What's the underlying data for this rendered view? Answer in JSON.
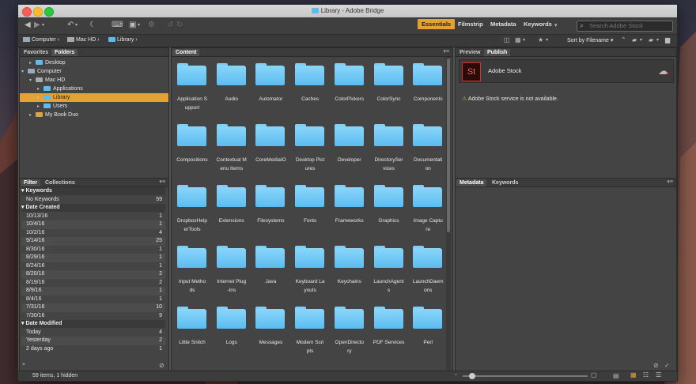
{
  "window": {
    "title": "Library - Adobe Bridge"
  },
  "toolbar": {
    "workspaces": [
      "Essentials",
      "Filmstrip",
      "Metadata",
      "Keywords"
    ],
    "active_workspace": "Essentials",
    "search_placeholder": "Search Adobe Stock"
  },
  "breadcrumb": [
    "Computer",
    "Mac HD",
    "Library"
  ],
  "sort": {
    "label": "Sort by Filename"
  },
  "favorites_tab": "Favorites",
  "folders_tab": "Folders",
  "tree": [
    {
      "label": "Desktop",
      "indent": 1,
      "arrow": "▸",
      "selected": false
    },
    {
      "label": "Computer",
      "indent": 0,
      "arrow": "▾",
      "selected": false
    },
    {
      "label": "Mac HD",
      "indent": 1,
      "arrow": "▾",
      "selected": false
    },
    {
      "label": "Applications",
      "indent": 2,
      "arrow": "▸",
      "selected": false
    },
    {
      "label": "Library",
      "indent": 2,
      "arrow": "▸",
      "selected": true
    },
    {
      "label": "Users",
      "indent": 2,
      "arrow": "▸",
      "selected": false
    },
    {
      "label": "My Book Duo",
      "indent": 1,
      "arrow": "▸",
      "selected": false
    }
  ],
  "filter_tab": "Filter",
  "collections_tab": "Collections",
  "filter": {
    "keywords_head": "Keywords",
    "keywords": [
      {
        "label": "No Keywords",
        "count": "59"
      }
    ],
    "date_created_head": "Date Created",
    "date_created": [
      {
        "label": "10/13/16",
        "count": "1"
      },
      {
        "label": "10/4/16",
        "count": "1"
      },
      {
        "label": "10/2/16",
        "count": "4"
      },
      {
        "label": "9/14/16",
        "count": "25"
      },
      {
        "label": "8/30/16",
        "count": "1"
      },
      {
        "label": "8/29/16",
        "count": "1"
      },
      {
        "label": "8/24/16",
        "count": "1"
      },
      {
        "label": "8/20/16",
        "count": "2"
      },
      {
        "label": "8/19/16",
        "count": "2"
      },
      {
        "label": "8/9/16",
        "count": "1"
      },
      {
        "label": "8/4/16",
        "count": "1"
      },
      {
        "label": "7/31/16",
        "count": "10"
      },
      {
        "label": "7/30/16",
        "count": "9"
      }
    ],
    "date_modified_head": "Date Modified",
    "date_modified": [
      {
        "label": "Today",
        "count": "4"
      },
      {
        "label": "Yesterday",
        "count": "2"
      },
      {
        "label": "2 days ago",
        "count": "1"
      }
    ]
  },
  "content_tab": "Content",
  "items": [
    [
      "Application S",
      "upport"
    ],
    [
      "Audio"
    ],
    [
      "Automator"
    ],
    [
      "Caches"
    ],
    [
      "ColorPickers"
    ],
    [
      "ColorSync"
    ],
    [
      "Components"
    ],
    [
      "Compositions"
    ],
    [
      "Contextual M",
      "enu Items"
    ],
    [
      "CoreMediaIO"
    ],
    [
      "Desktop Pict",
      "ures"
    ],
    [
      "Developer"
    ],
    [
      "DirectorySer",
      "vices"
    ],
    [
      "Documentati",
      "on"
    ],
    [
      "DropboxHelp",
      "erTools"
    ],
    [
      "Extensions"
    ],
    [
      "Filesystems"
    ],
    [
      "Fonts"
    ],
    [
      "Frameworks"
    ],
    [
      "Graphics"
    ],
    [
      "Image Captu",
      "re"
    ],
    [
      "Input Metho",
      "ds"
    ],
    [
      "Internet Plug",
      "-Ins"
    ],
    [
      "Java"
    ],
    [
      "Keyboard La",
      "youts"
    ],
    [
      "Keychains"
    ],
    [
      "LaunchAgent",
      "s"
    ],
    [
      "LaunchDaem",
      "ons"
    ],
    [
      "Little Snitch"
    ],
    [
      "Logs"
    ],
    [
      "Messages"
    ],
    [
      "Modem Scri",
      "pts"
    ],
    [
      "OpenDirecto",
      "ry"
    ],
    [
      "PDF Services"
    ],
    [
      "Perl"
    ]
  ],
  "preview_tab": "Preview",
  "publish_tab": "Publish",
  "stock": {
    "logo": "St",
    "name": "Adobe Stock",
    "warning": "Adobe Stock service is not available."
  },
  "metadata_tab": "Metadata",
  "keywords_tab": "Keywords",
  "status": {
    "count": "59 items, 1 hidden"
  },
  "colors": {
    "accent": "#e3a232",
    "folder": "#5bbcf0",
    "stock_red": "#d4302a"
  }
}
